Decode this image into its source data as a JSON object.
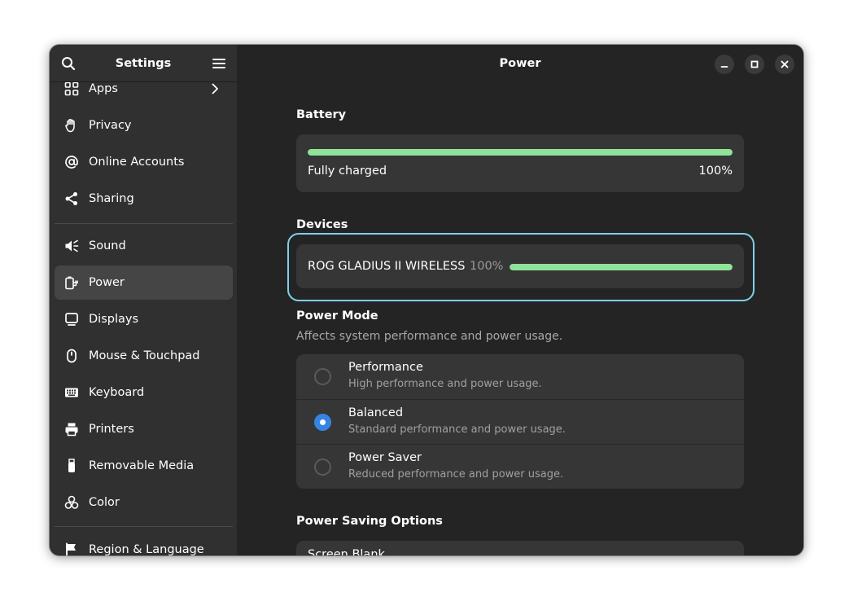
{
  "sidebar": {
    "title": "Settings",
    "items": [
      {
        "label": "Apps",
        "icon": "apps-grid-icon",
        "has_chevron": true
      },
      {
        "label": "Privacy",
        "icon": "hand-icon"
      },
      {
        "label": "Online Accounts",
        "icon": "at-sign-icon"
      },
      {
        "label": "Sharing",
        "icon": "share-icon"
      },
      {
        "label": "Sound",
        "icon": "speaker-icon"
      },
      {
        "label": "Power",
        "icon": "power-plug-icon",
        "active": true
      },
      {
        "label": "Displays",
        "icon": "monitor-icon"
      },
      {
        "label": "Mouse & Touchpad",
        "icon": "mouse-icon"
      },
      {
        "label": "Keyboard",
        "icon": "keyboard-icon"
      },
      {
        "label": "Printers",
        "icon": "printer-icon"
      },
      {
        "label": "Removable Media",
        "icon": "usb-drive-icon"
      },
      {
        "label": "Color",
        "icon": "color-circles-icon"
      },
      {
        "label": "Region & Language",
        "icon": "flag-icon"
      }
    ]
  },
  "header": {
    "title": "Power"
  },
  "battery": {
    "heading": "Battery",
    "status": "Fully charged",
    "percent_text": "100%",
    "level": 1.0
  },
  "devices": {
    "heading": "Devices",
    "items": [
      {
        "name": "ROG GLADIUS II WIRELESS",
        "percent_text": "100%",
        "level": 1.0
      }
    ]
  },
  "power_mode": {
    "heading": "Power Mode",
    "subtitle": "Affects system performance and power usage.",
    "options": [
      {
        "title": "Performance",
        "description": "High performance and power usage.",
        "selected": false
      },
      {
        "title": "Balanced",
        "description": "Standard performance and power usage.",
        "selected": true
      },
      {
        "title": "Power Saver",
        "description": "Reduced performance and power usage.",
        "selected": false
      }
    ]
  },
  "power_saving": {
    "heading": "Power Saving Options",
    "first_row": "Screen Blank"
  },
  "colors": {
    "accent": "#3584e4",
    "battery_fill": "#8fe39a",
    "focus_ring": "#7fd0e8"
  }
}
